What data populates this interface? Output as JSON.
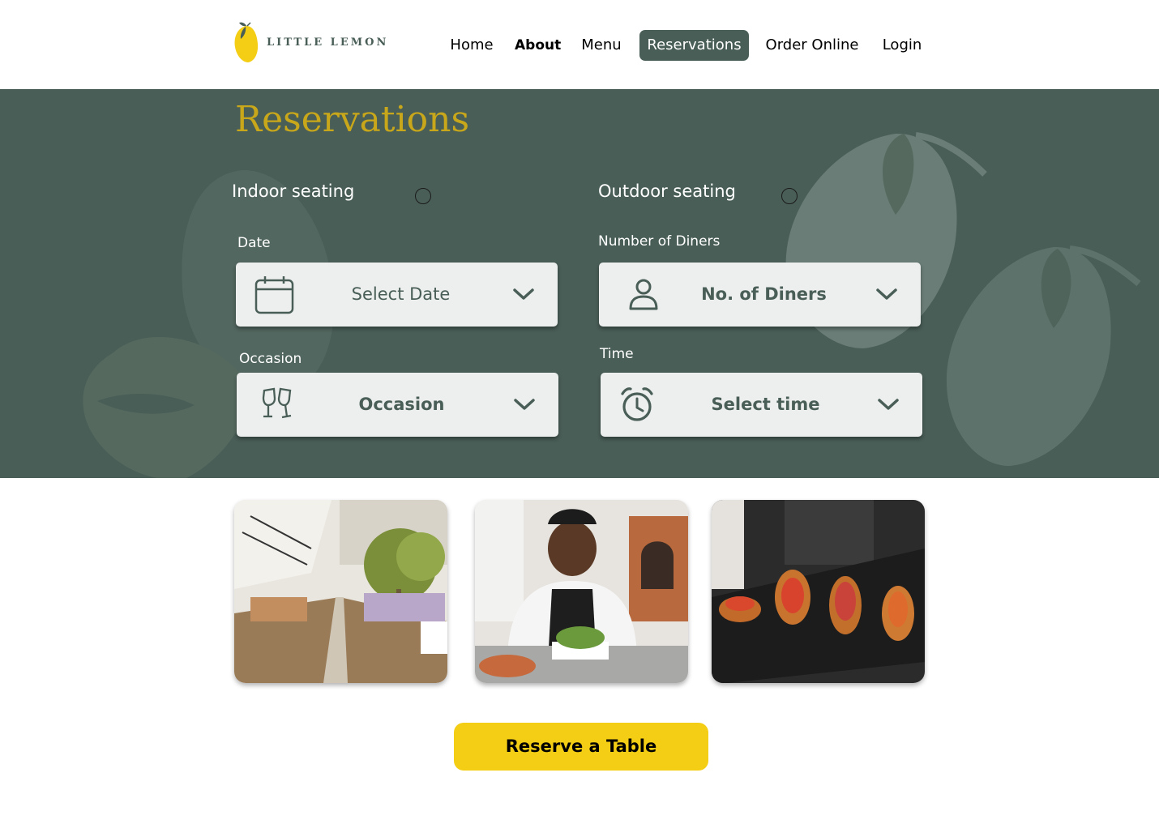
{
  "brand": {
    "name": "LITTLE LEMON",
    "accent": "#f4ce14",
    "primary": "#495e57",
    "title_color": "#c9a71a"
  },
  "nav": {
    "items": [
      {
        "label": "Home",
        "active": false
      },
      {
        "label": "About",
        "active": false
      },
      {
        "label": "Menu",
        "active": false
      },
      {
        "label": "Reservations",
        "active": true
      },
      {
        "label": "Order Online",
        "active": false
      },
      {
        "label": "Login",
        "active": false
      }
    ]
  },
  "hero": {
    "title": "Reservations",
    "indoor_label": "Indoor seating",
    "outdoor_label": "Outdoor seating"
  },
  "form": {
    "date": {
      "label": "Date",
      "placeholder": "Select Date",
      "icon": "calendar-icon"
    },
    "diners": {
      "label": "Number of Diners",
      "placeholder": "No. of Diners",
      "icon": "person-icon"
    },
    "occasion": {
      "label": "Occasion",
      "placeholder": "Occasion",
      "icon": "wine-glasses-icon"
    },
    "time": {
      "label": "Time",
      "placeholder": "Select time",
      "icon": "alarm-clock-icon"
    }
  },
  "photos": [
    {
      "subject": "restaurant-terrace"
    },
    {
      "subject": "chef-plating"
    },
    {
      "subject": "bruschetta-platter"
    }
  ],
  "cta": {
    "label": "Reserve a Table"
  }
}
